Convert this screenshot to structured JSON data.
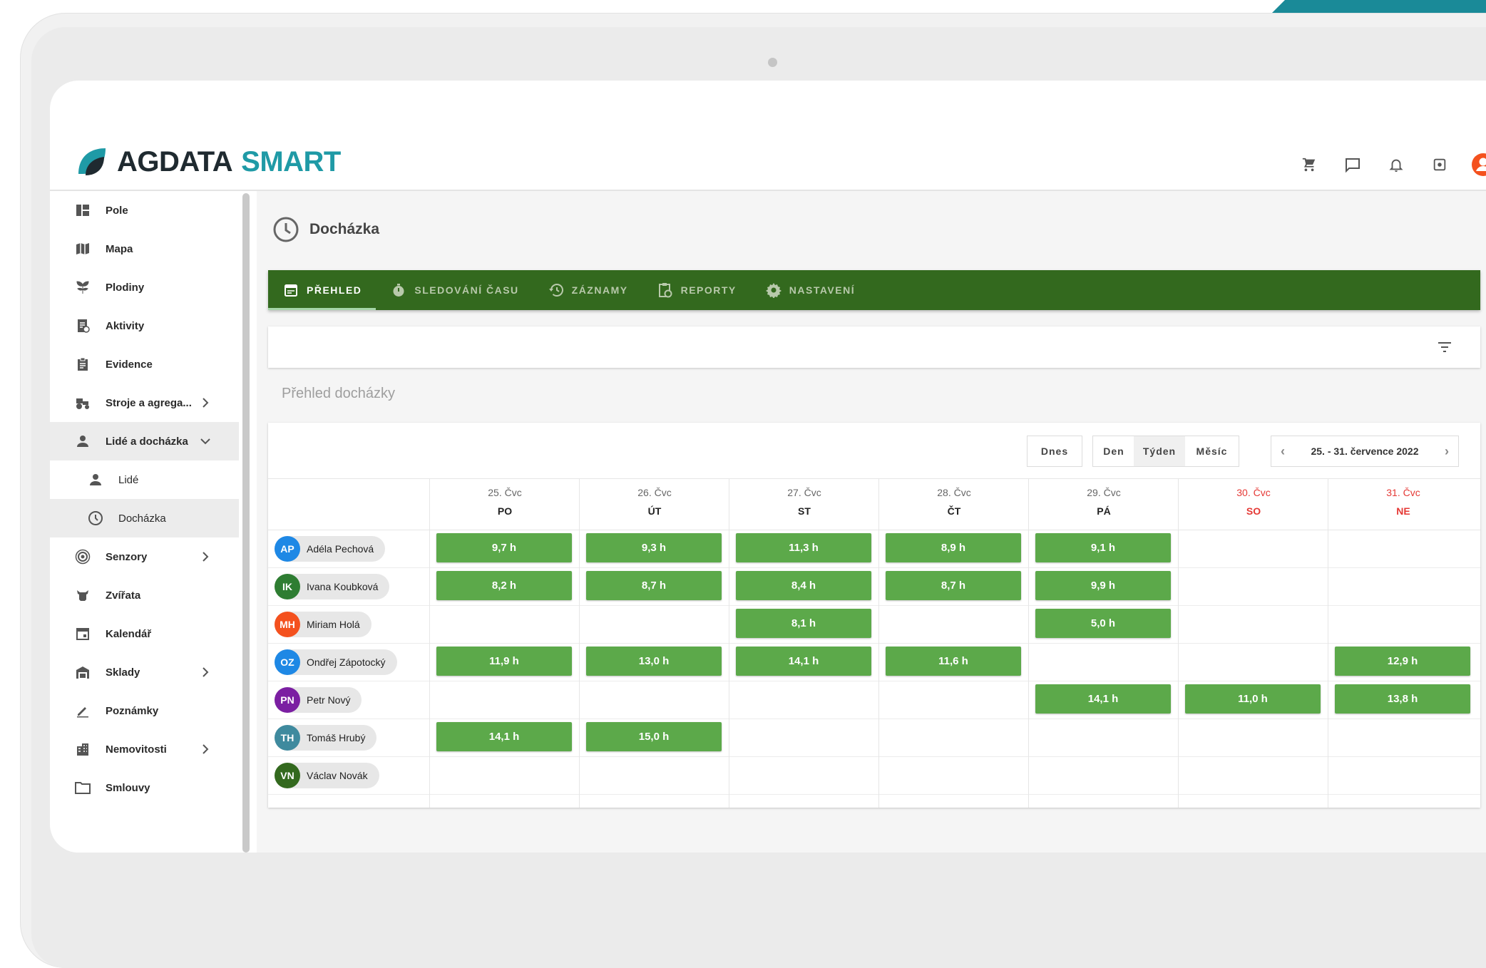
{
  "app": {
    "logo_primary": "AGDATA",
    "logo_secondary": "SMART",
    "brand_color": "#1f9aa6",
    "accent_green": "#33691e",
    "hours_green": "#5ca94a"
  },
  "header_icons": [
    "cart-icon",
    "chat-icon",
    "bell-icon",
    "settings-icon",
    "account-icon"
  ],
  "sidebar": {
    "items": [
      {
        "label": "Pole",
        "icon": "dashboard-icon"
      },
      {
        "label": "Mapa",
        "icon": "map-icon"
      },
      {
        "label": "Plodiny",
        "icon": "plant-icon"
      },
      {
        "label": "Aktivity",
        "icon": "activity-icon"
      },
      {
        "label": "Evidence",
        "icon": "clipboard-icon"
      },
      {
        "label": "Stroje a agrega...",
        "icon": "tractor-icon"
      },
      {
        "label": "Lidé a docházka",
        "icon": "person-icon"
      },
      {
        "label": "Lidé",
        "icon": "person-icon"
      },
      {
        "label": "Docházka",
        "icon": "clock-icon"
      },
      {
        "label": "Senzory",
        "icon": "sensor-icon"
      },
      {
        "label": "Zvířata",
        "icon": "animal-icon"
      },
      {
        "label": "Kalendář",
        "icon": "calendar-icon"
      },
      {
        "label": "Sklady",
        "icon": "warehouse-icon"
      },
      {
        "label": "Poznámky",
        "icon": "pencil-icon"
      },
      {
        "label": "Nemovitosti",
        "icon": "building-icon"
      },
      {
        "label": "Smlouvy",
        "icon": "folder-icon"
      }
    ]
  },
  "page": {
    "title": "Docházka",
    "section_label": "Přehled docházky"
  },
  "tabs": [
    {
      "label": "PŘEHLED",
      "icon": "calendar-icon"
    },
    {
      "label": "SLEDOVÁNÍ ČASU",
      "icon": "stopwatch-icon"
    },
    {
      "label": "ZÁZNAMY",
      "icon": "history-icon"
    },
    {
      "label": "REPORTY",
      "icon": "report-icon"
    },
    {
      "label": "NASTAVENÍ",
      "icon": "gear-icon"
    }
  ],
  "calendar": {
    "today_label": "Dnes",
    "view_day": "Den",
    "view_week": "Týden",
    "view_month": "Měsíc",
    "range": "25. - 31. července 2022",
    "days": [
      {
        "date": "25. Čvc",
        "weekday": "PO"
      },
      {
        "date": "26. Čvc",
        "weekday": "ÚT"
      },
      {
        "date": "27. Čvc",
        "weekday": "ST"
      },
      {
        "date": "28. Čvc",
        "weekday": "ČT"
      },
      {
        "date": "29. Čvc",
        "weekday": "PÁ"
      },
      {
        "date": "30. Čvc",
        "weekday": "SO"
      },
      {
        "date": "31. Čvc",
        "weekday": "NE"
      }
    ],
    "people": [
      {
        "initials": "AP",
        "name": "Adéla Pechová",
        "color": "#1e88e5",
        "hours": [
          "9,7 h",
          "9,3 h",
          "11,3 h",
          "8,9 h",
          "9,1 h",
          "",
          ""
        ]
      },
      {
        "initials": "IK",
        "name": "Ivana Koubková",
        "color": "#2e7d32",
        "hours": [
          "8,2 h",
          "8,7 h",
          "8,4 h",
          "8,7 h",
          "9,9 h",
          "",
          ""
        ]
      },
      {
        "initials": "MH",
        "name": "Miriam Holá",
        "color": "#f4511e",
        "hours": [
          "",
          "",
          "8,1 h",
          "",
          "5,0 h",
          "",
          ""
        ]
      },
      {
        "initials": "OZ",
        "name": "Ondřej Zápotocký",
        "color": "#1e88e5",
        "hours": [
          "11,9 h",
          "13,0 h",
          "14,1 h",
          "11,6 h",
          "",
          "",
          "12,9 h"
        ]
      },
      {
        "initials": "PN",
        "name": "Petr Nový",
        "color": "#7b1fa2",
        "hours": [
          "",
          "",
          "",
          "",
          "14,1 h",
          "11,0 h",
          "13,8 h"
        ]
      },
      {
        "initials": "TH",
        "name": "Tomáš Hrubý",
        "color": "#3f8a9e",
        "hours": [
          "14,1 h",
          "15,0 h",
          "",
          "",
          "",
          "",
          ""
        ]
      },
      {
        "initials": "VN",
        "name": "Václav Novák",
        "color": "#33691e",
        "hours": [
          "",
          "",
          "",
          "",
          "",
          "",
          ""
        ]
      }
    ]
  }
}
